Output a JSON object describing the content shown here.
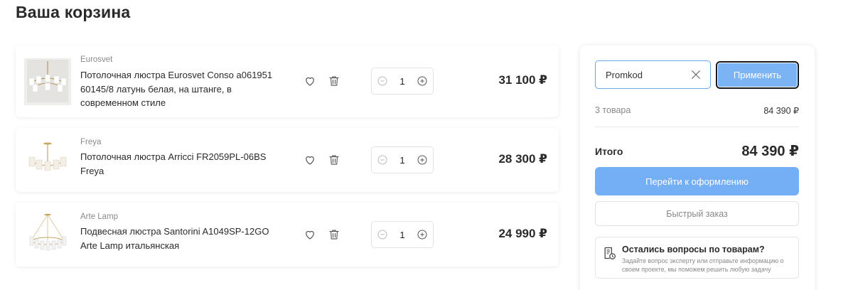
{
  "page": {
    "title": "Ваша корзина"
  },
  "cart": {
    "items": [
      {
        "brand": "Eurosvet",
        "name": "Потолочная люстра Eurosvet Conso a061951 60145/8 латунь белая, на штанге, в современном стиле",
        "quantity": "1",
        "price": "31 100 ₽"
      },
      {
        "brand": "Freya",
        "name": "Потолочная люстра Arricci FR2059PL-06BS Freya",
        "quantity": "1",
        "price": "28 300 ₽"
      },
      {
        "brand": "Arte Lamp",
        "name": "Подвесная люстра Santorini A1049SP-12GO Arte Lamp итальянская",
        "quantity": "1",
        "price": "24 990 ₽"
      }
    ]
  },
  "summary": {
    "promo": {
      "value": "Promkod",
      "apply_label": "Применить"
    },
    "count_label": "3 товара",
    "count_value": "84 390 ₽",
    "total_label": "Итого",
    "total_value": "84 390 ₽",
    "checkout_label": "Перейти к оформлению",
    "quick_order_label": "Быстрый заказ",
    "help": {
      "title": "Остались вопросы по товарам?",
      "text": "Задайте вопрос эксперту или отправьте информацию о своем проекте, мы поможем решить любую задачу"
    }
  },
  "colors": {
    "accent": "#74aef4",
    "text": "#2a2a2a",
    "muted": "#8a8a8a"
  },
  "icons": [
    "heart-icon",
    "trash-icon",
    "minus-icon",
    "plus-icon",
    "close-icon",
    "document-question-icon"
  ]
}
